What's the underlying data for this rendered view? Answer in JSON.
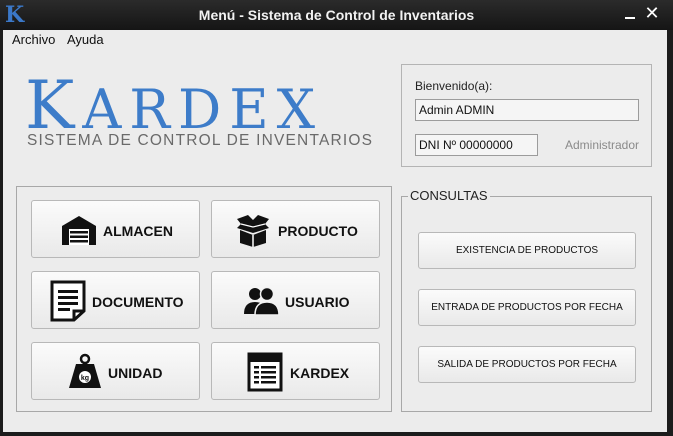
{
  "window": {
    "title": "Menú - Sistema de Control de Inventarios",
    "app_icon_letter": "K",
    "close_glyph": "✕"
  },
  "menu": {
    "archivo": "Archivo",
    "ayuda": "Ayuda"
  },
  "logo": {
    "first": "K",
    "rest": "ARDEX",
    "subtitle": "SISTEMA DE CONTROL DE INVENTARIOS",
    "color": "#3d7cc9"
  },
  "user": {
    "welcome_label": "Bienvenido(a):",
    "name": "Admin ADMIN",
    "dni": "DNI Nº 00000000",
    "role": "Administrador"
  },
  "modules": {
    "almacen": "ALMACEN",
    "producto": "PRODUCTO",
    "documento": "DOCUMENTO",
    "usuario": "USUARIO",
    "unidad": "UNIDAD",
    "kardex": "KARDEX",
    "icons": [
      "warehouse-icon",
      "boxes-icon",
      "document-icon",
      "users-icon",
      "weight-icon",
      "kardex-sheet-icon"
    ]
  },
  "consultas": {
    "title": "CONSULTAS",
    "existencia": "EXISTENCIA DE PRODUCTOS",
    "entrada": "ENTRADA DE PRODUCTOS POR FECHA",
    "salida": "SALIDA DE PRODUCTOS POR FECHA"
  }
}
